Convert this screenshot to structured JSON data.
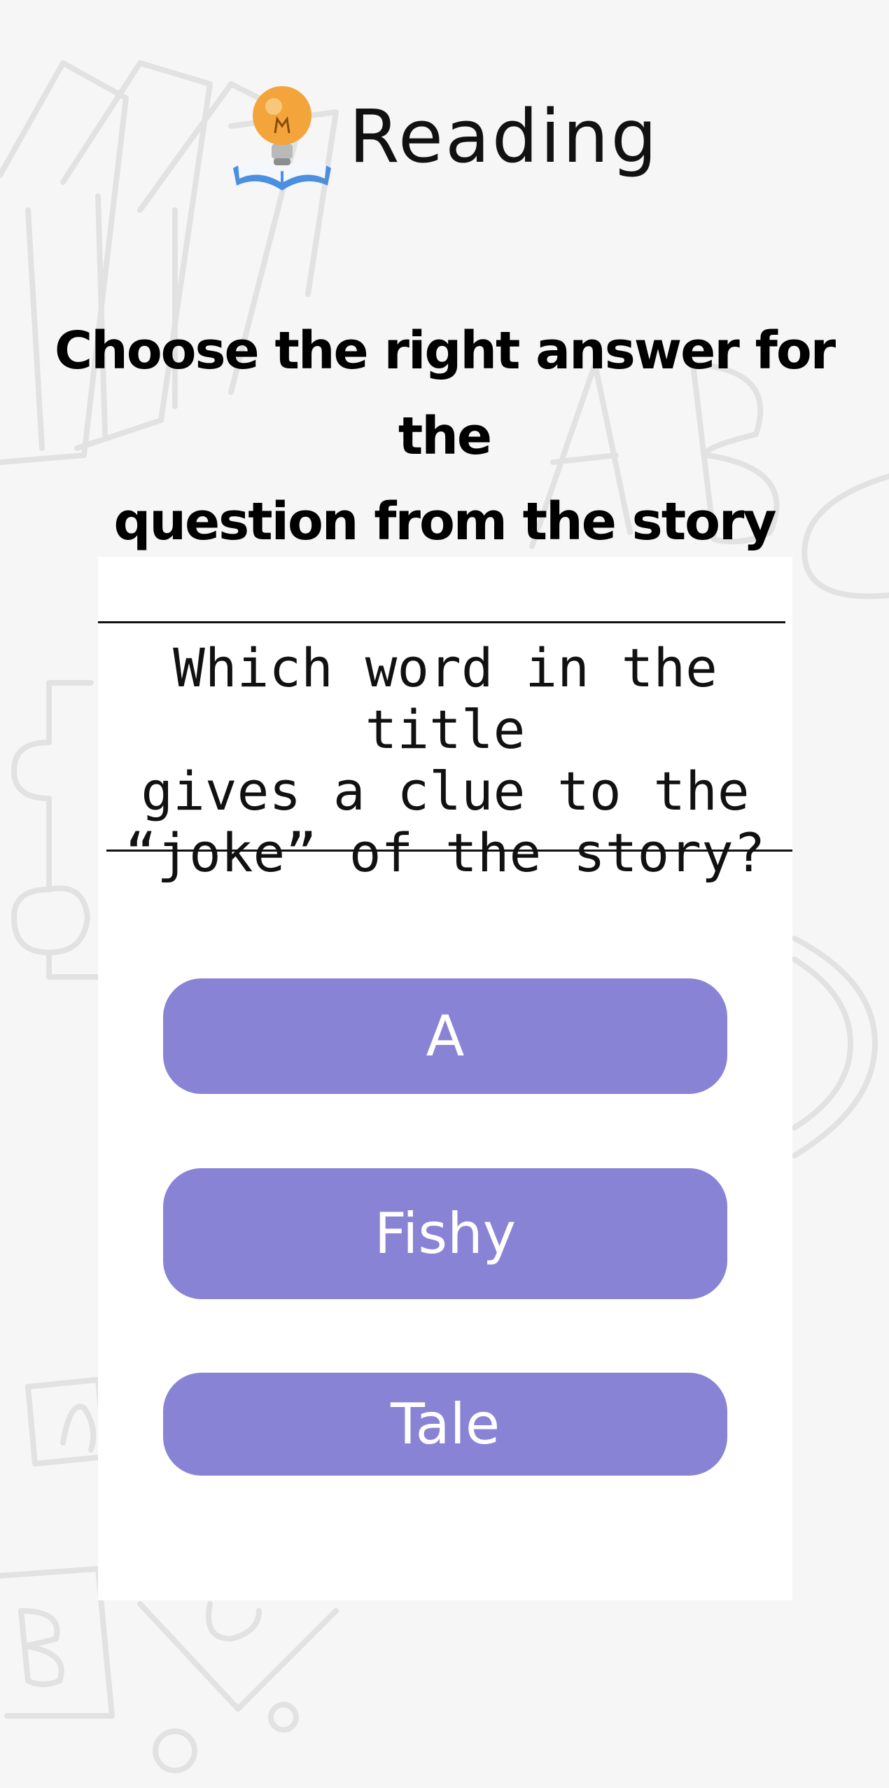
{
  "header": {
    "title": "Reading",
    "icon": "lightbulb-book-icon"
  },
  "instruction": {
    "line1": "Choose the right answer for the",
    "line2": "question from the story"
  },
  "question": {
    "line1": "Which word in the title",
    "line2": "gives a clue to the",
    "line3": "“joke” of the story?"
  },
  "answers": [
    "A",
    "Fishy",
    "Tale"
  ],
  "colors": {
    "answer_button": "#8983d6",
    "background": "#f6f6f6",
    "card": "#ffffff"
  }
}
